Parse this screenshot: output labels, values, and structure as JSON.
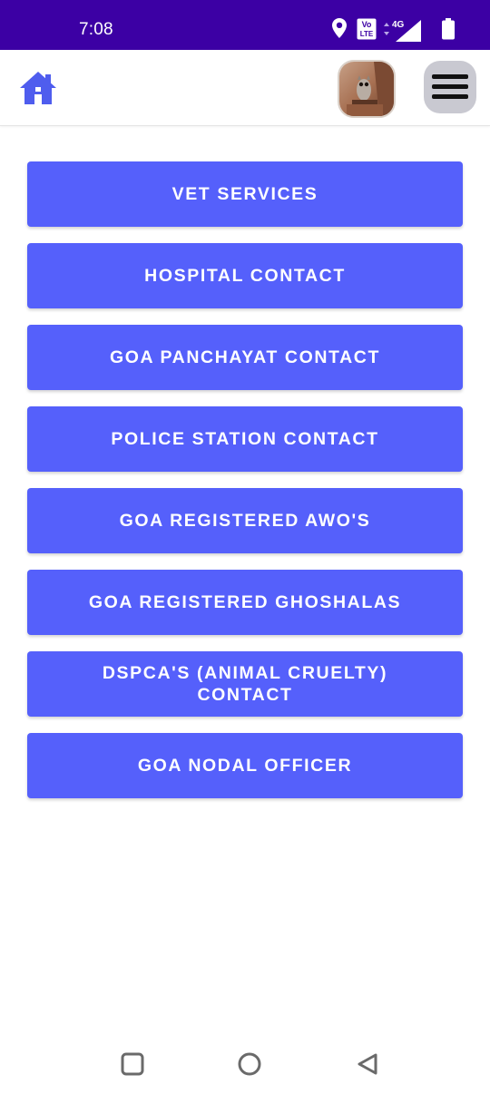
{
  "status_bar": {
    "time": "7:08",
    "icons": [
      "location-icon",
      "volte-icon",
      "signal-4g-icon",
      "battery-icon"
    ],
    "volte_text": [
      "Vo",
      "LTE"
    ],
    "network_text": "4G"
  },
  "header": {
    "home_icon": "home-icon",
    "avatar": "profile-avatar",
    "menu_icon": "hamburger-menu-icon"
  },
  "menu": {
    "items": [
      {
        "label": "VET SERVICES"
      },
      {
        "label": "HOSPITAL CONTACT"
      },
      {
        "label": "GOA PANCHAYAT CONTACT"
      },
      {
        "label": "POLICE STATION CONTACT"
      },
      {
        "label": "GOA REGISTERED AWO'S"
      },
      {
        "label": "GOA REGISTERED GHOSHALAS"
      },
      {
        "label": "DSPCA'S (ANIMAL CRUELTY) CONTACT"
      },
      {
        "label": "GOA NODAL OFFICER"
      }
    ]
  },
  "nav_bar": {
    "icons": [
      "recents-square-icon",
      "home-circle-icon",
      "back-triangle-icon"
    ]
  },
  "colors": {
    "status_bar": "#3c00a4",
    "accent": "#5560fb",
    "button_text": "#ffffff",
    "menu_button_bg": "#c9c9d1"
  }
}
